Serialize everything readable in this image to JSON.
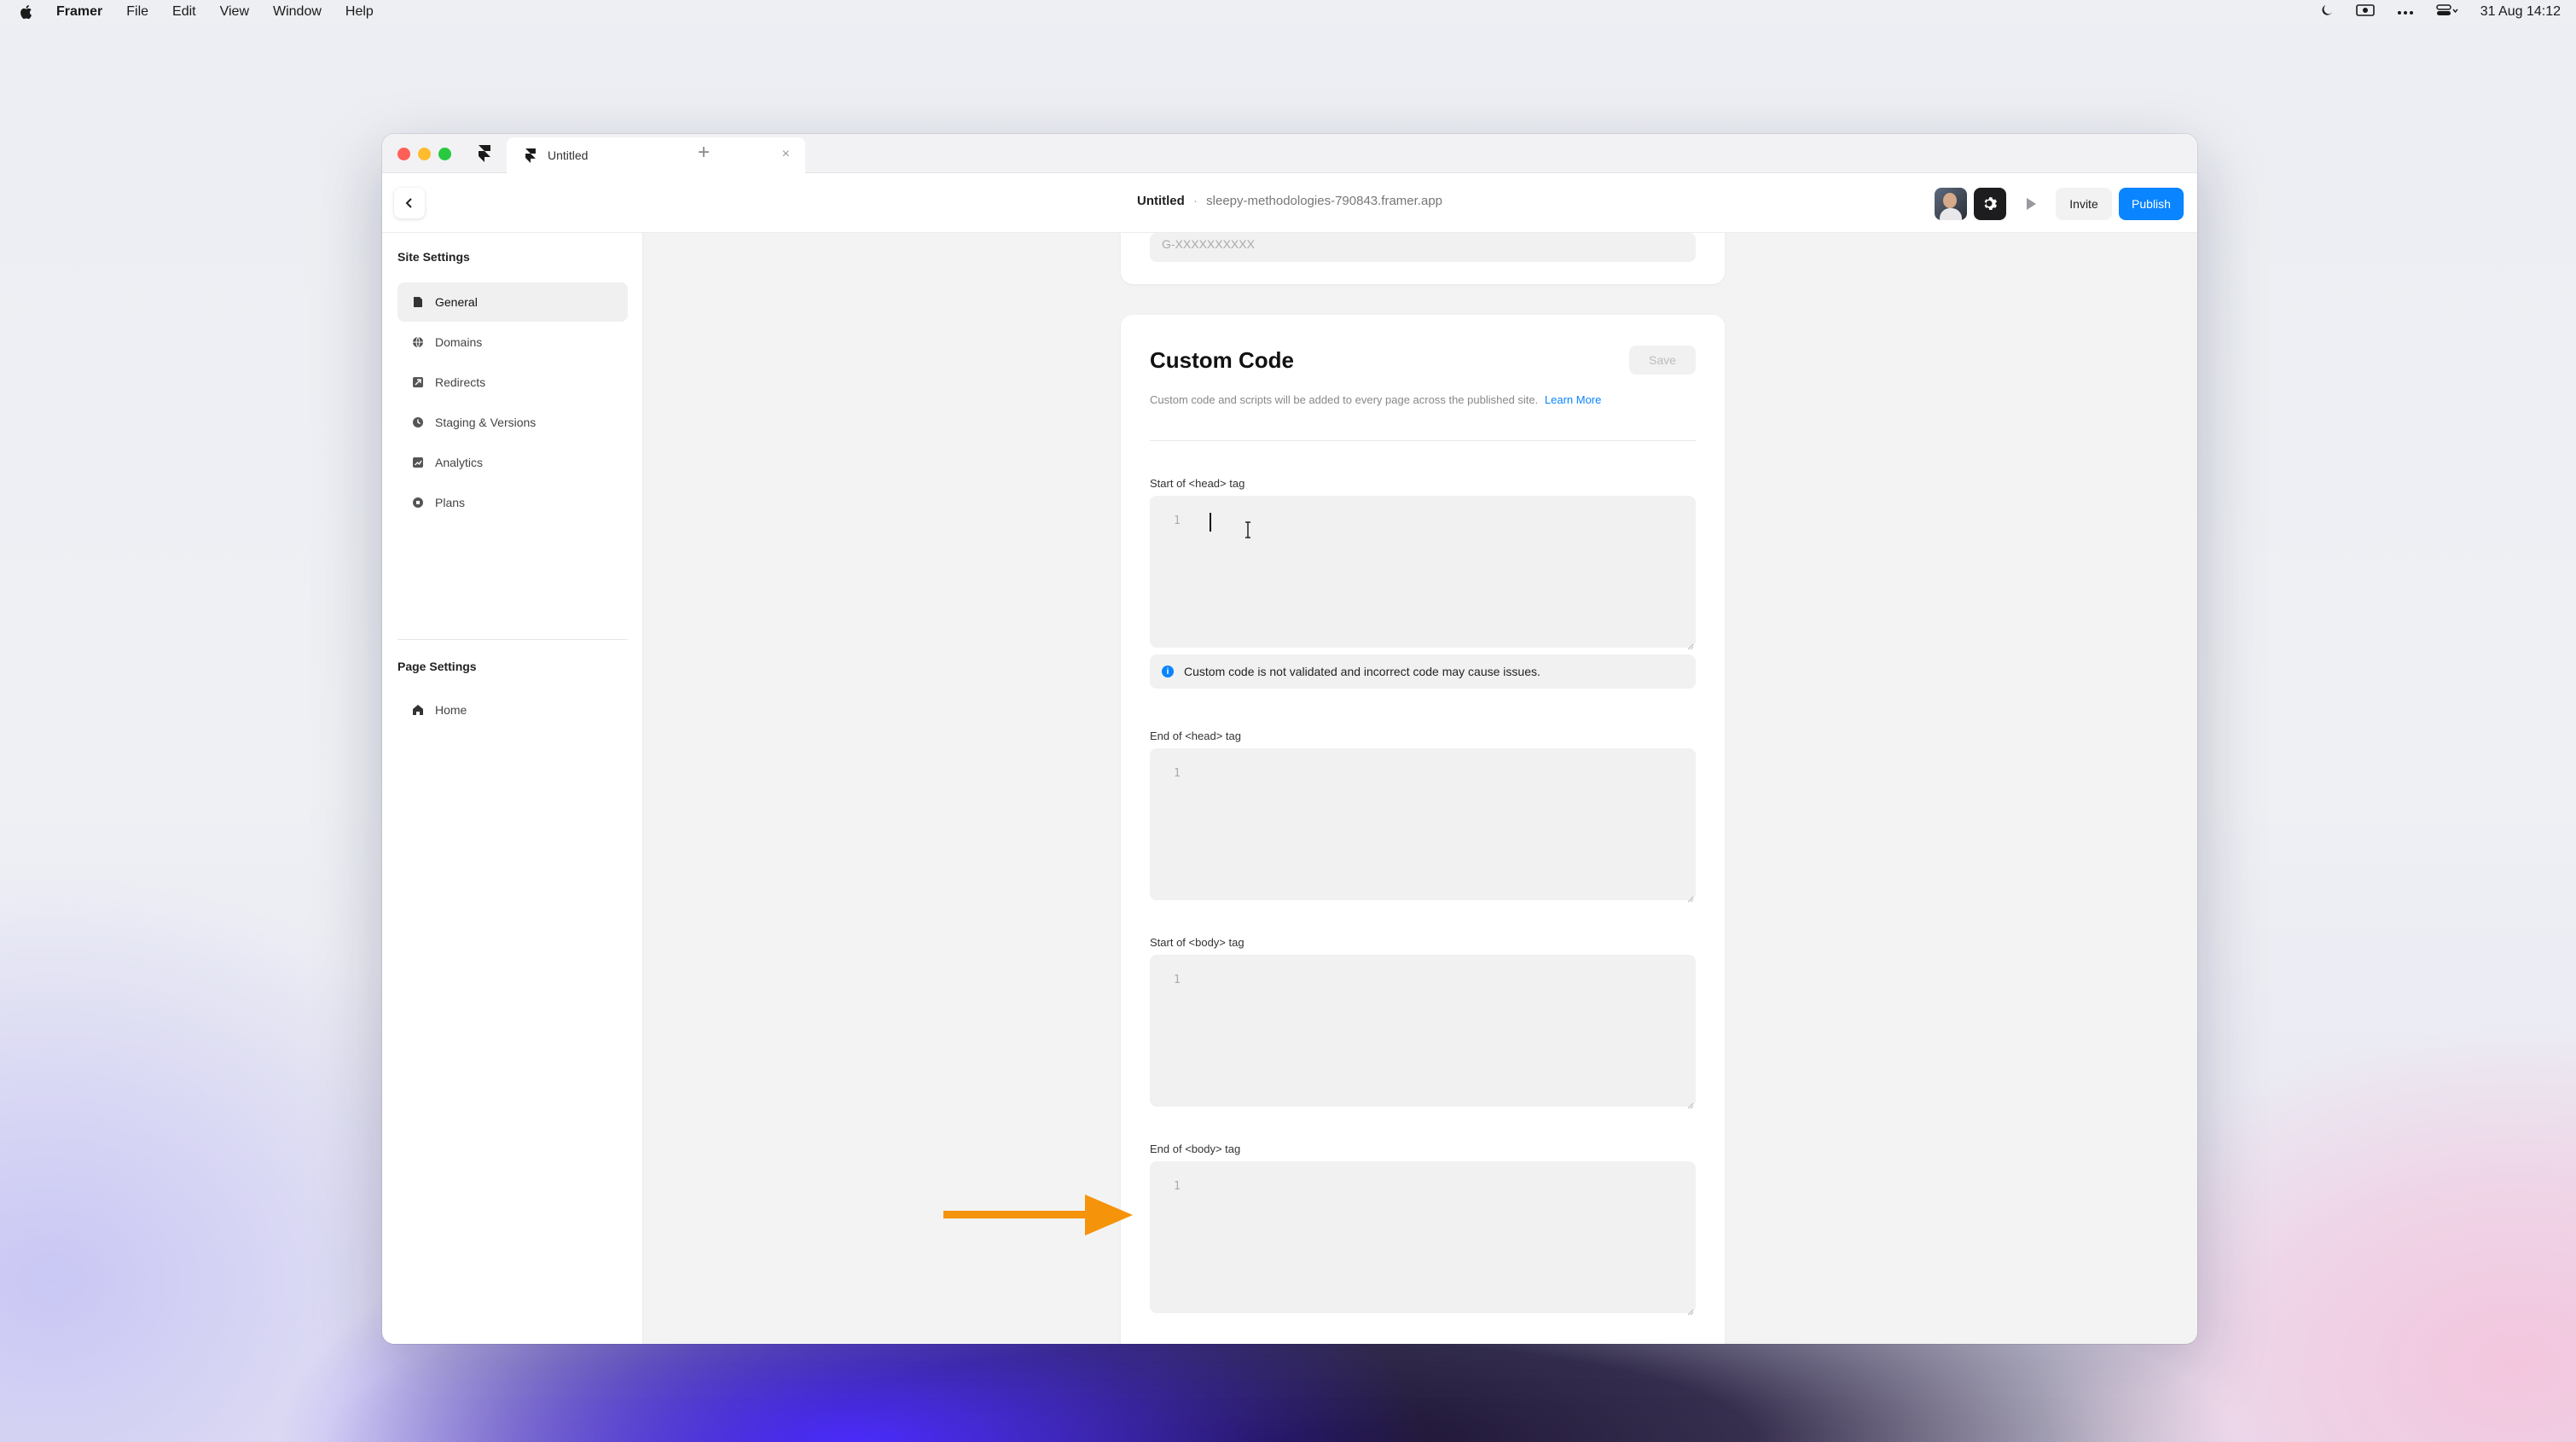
{
  "menubar": {
    "app_name": "Framer",
    "items": [
      "File",
      "Edit",
      "View",
      "Window",
      "Help"
    ],
    "clock": "31 Aug  14:12"
  },
  "browser": {
    "tab_title": "Untitled",
    "tab_close": "×",
    "new_tab": "+"
  },
  "toolbar": {
    "project_name": "Untitled",
    "separator": "·",
    "domain": "sleepy-methodologies-790843.framer.app",
    "invite_label": "Invite",
    "publish_label": "Publish"
  },
  "sidebar": {
    "site_heading": "Site Settings",
    "site_items": [
      {
        "label": "General",
        "icon": "document-icon",
        "active": true
      },
      {
        "label": "Domains",
        "icon": "globe-icon"
      },
      {
        "label": "Redirects",
        "icon": "redirect-icon"
      },
      {
        "label": "Staging & Versions",
        "icon": "clock-icon"
      },
      {
        "label": "Analytics",
        "icon": "chart-icon"
      },
      {
        "label": "Plans",
        "icon": "plan-icon"
      }
    ],
    "page_heading": "Page Settings",
    "page_items": [
      {
        "label": "Home",
        "icon": "home-icon"
      }
    ]
  },
  "analytics_card": {
    "ga_placeholder": "G-XXXXXXXXXX"
  },
  "custom_code": {
    "title": "Custom Code",
    "save_label": "Save",
    "description": "Custom code and scripts will be added to every page across the published site.",
    "learn_more": "Learn More",
    "fields": [
      {
        "label": "Start of <head> tag",
        "line": "1"
      },
      {
        "label": "End of <head> tag",
        "line": "1"
      },
      {
        "label": "Start of <body> tag",
        "line": "1"
      },
      {
        "label": "End of <body> tag",
        "line": "1"
      }
    ],
    "warning": "Custom code is not validated and incorrect code may cause issues."
  },
  "colors": {
    "accent": "#0a84ff",
    "annotation_arrow": "#f5930a"
  }
}
